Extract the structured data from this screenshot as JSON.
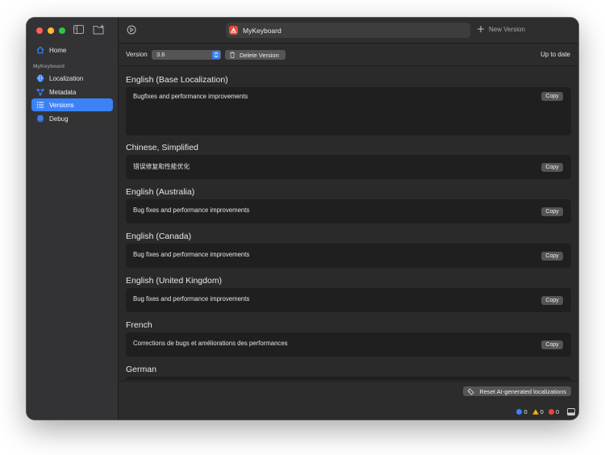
{
  "sidebar": {
    "home_label": "Home",
    "section_label": "MyKeyboard",
    "items": [
      {
        "label": "Localization",
        "icon": "globe-icon",
        "color": "#3b82f6"
      },
      {
        "label": "Metadata",
        "icon": "share-nodes-icon",
        "color": "#3b82f6"
      },
      {
        "label": "Versions",
        "icon": "list-icon",
        "color": "#ffffff"
      },
      {
        "label": "Debug",
        "icon": "database-icon",
        "color": "#3b82f6"
      }
    ]
  },
  "toolbar": {
    "app_title": "MyKeyboard",
    "new_version_label": "New Version"
  },
  "version_bar": {
    "label": "Version",
    "selected_version": "3.6",
    "delete_label": "Delete Version",
    "status": "Up to date"
  },
  "copy_label": "Copy",
  "localizations": [
    {
      "language": "English (Base Localization)",
      "text": "Bugfixes and performance improvements"
    },
    {
      "language": "Chinese, Simplified",
      "text": "错误修复和性能优化"
    },
    {
      "language": "English (Australia)",
      "text": "Bug fixes and performance improvements"
    },
    {
      "language": "English (Canada)",
      "text": "Bug fixes and performance improvements"
    },
    {
      "language": "English (United Kingdom)",
      "text": "Bug fixes and performance improvements"
    },
    {
      "language": "French",
      "text": "Corrections de bugs et améliorations des performances"
    },
    {
      "language": "German",
      "text": ""
    }
  ],
  "bottom_bar": {
    "reset_label": "Reset AI-generated localizations",
    "info_count": "0",
    "warning_count": "0",
    "error_count": "0"
  },
  "colors": {
    "accent": "#3b82f6",
    "warning": "#f5b400",
    "error": "#e5483b"
  }
}
